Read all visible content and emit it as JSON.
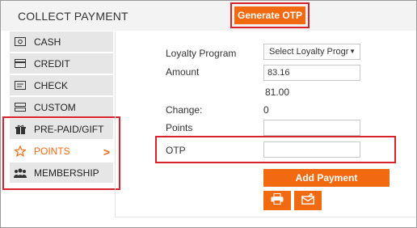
{
  "header": {
    "title": "COLLECT PAYMENT",
    "generate_otp_label": "Generate OTP"
  },
  "sidebar": {
    "items": [
      {
        "label": "CASH",
        "icon": "cash-icon"
      },
      {
        "label": "CREDIT",
        "icon": "credit-card-icon"
      },
      {
        "label": "CHECK",
        "icon": "check-icon"
      },
      {
        "label": "CUSTOM",
        "icon": "custom-icon"
      },
      {
        "label": "PRE-PAID/GIFT",
        "icon": "gift-icon"
      },
      {
        "label": "POINTS",
        "icon": "star-icon",
        "active": true
      },
      {
        "label": "MEMBERSHIP",
        "icon": "people-icon"
      }
    ]
  },
  "form": {
    "loyalty_label": "Loyalty Program",
    "loyalty_select_value": "Select Loyalty Progr",
    "amount_label": "Amount",
    "amount_value": "83.16",
    "amount_sub": "81.00",
    "change_label": "Change:",
    "change_value": "0",
    "points_label": "Points",
    "points_value": "",
    "otp_label": "OTP",
    "otp_value": ""
  },
  "actions": {
    "add_payment_label": "Add Payment",
    "print_icon": "print-icon",
    "email_icon": "email-icon"
  },
  "colors": {
    "accent": "#f26a10",
    "highlight": "#d9232b"
  }
}
